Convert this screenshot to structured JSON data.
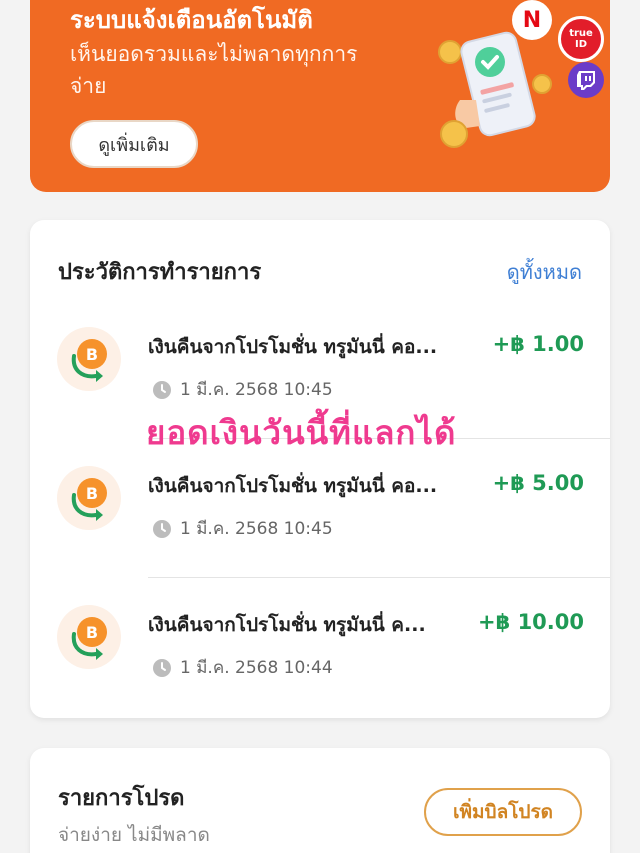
{
  "banner": {
    "title": "ระบบแจ้งเตือนอัตโนมัติ",
    "subtitle": "เห็นยอดรวมและไม่พลาดทุกการจ่าย",
    "button_label": "ดูเพิ่มเติม",
    "netflix_logo": "N",
    "trueid_top": "true",
    "trueid_bottom": "ID",
    "accent_color": "#f06a23"
  },
  "history": {
    "title": "ประวัติการทำรายการ",
    "view_all_label": "ดูทั้งหมด",
    "transactions": [
      {
        "name": "เงินคืนจากโปรโมชั่น ทรูมันนี่ คอ...",
        "amount": "+฿ 1.00",
        "time": "1 มี.ค. 2568 10:45",
        "icon": "bitcoin-refund-icon"
      },
      {
        "name": "เงินคืนจากโปรโมชั่น ทรูมันนี่ คอ...",
        "amount": "+฿ 5.00",
        "time": "1 มี.ค. 2568 10:45",
        "icon": "bitcoin-refund-icon"
      },
      {
        "name": "เงินคืนจากโปรโมชั่น ทรูมันนี่ ค...",
        "amount": "+฿ 10.00",
        "time": "1 มี.ค. 2568 10:44",
        "icon": "bitcoin-refund-icon"
      }
    ],
    "amount_color": "#1f9a55"
  },
  "overlay_caption": "ยอดเงินวันนี้ที่แลกได้",
  "bills": {
    "title": "รายการโปรด",
    "subtitle": "จ่ายง่าย ไม่มีพลาด",
    "button_label": "เพิ่มบิลโปรด"
  }
}
